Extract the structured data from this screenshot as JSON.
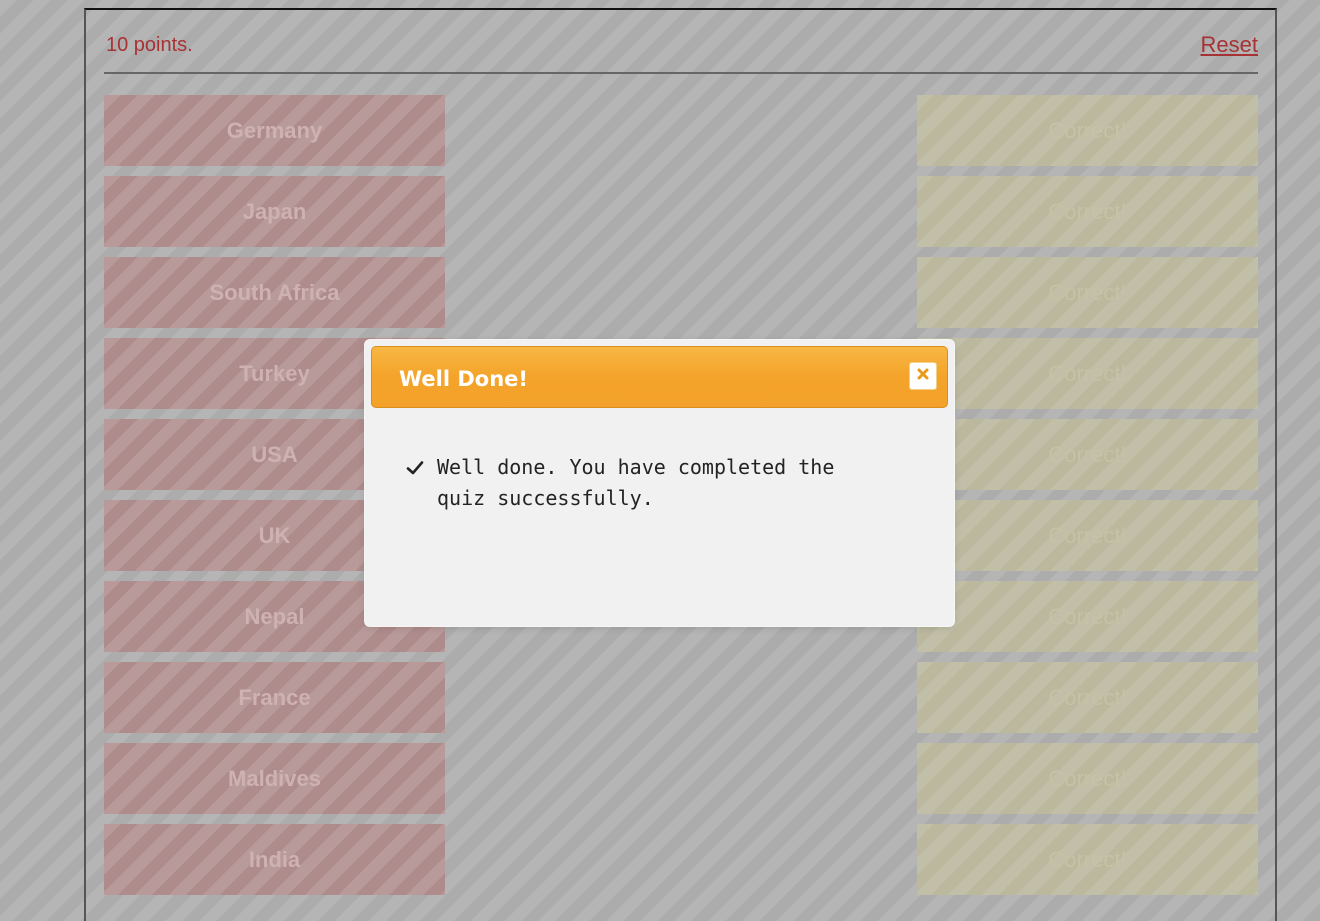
{
  "topbar": {
    "score_text": "10 points.",
    "reset_label": "Reset"
  },
  "countries": [
    "Germany",
    "Japan",
    "South Africa",
    "Turkey",
    "USA",
    "UK",
    "Nepal",
    "France",
    "Maldives",
    "India"
  ],
  "answers": [
    "Correct!",
    "Correct!",
    "Correct!",
    "Correct!",
    "Correct!",
    "Correct!",
    "Correct!",
    "Correct!",
    "Correct!",
    "Correct!"
  ],
  "dialog": {
    "title": "Well Done!",
    "message": "Well done. You have completed the quiz successfully.",
    "close_icon": "close-icon",
    "check_icon": "check-icon"
  },
  "colors": {
    "accent": "#a73234",
    "dialog_header": "#f4a42a"
  }
}
